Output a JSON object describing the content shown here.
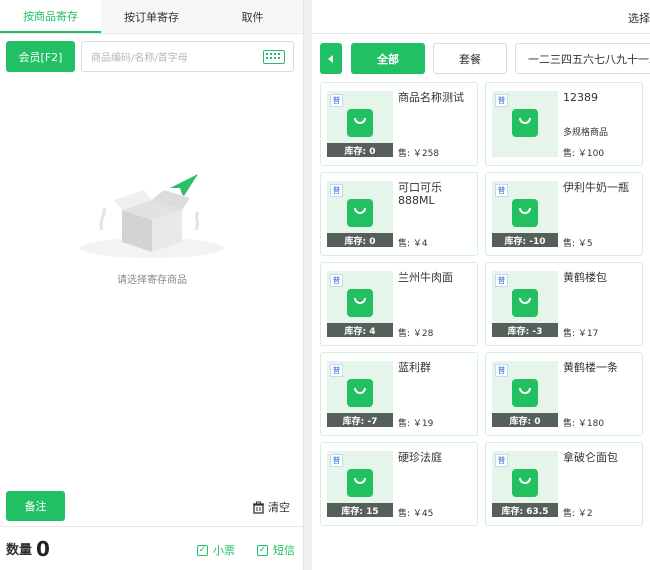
{
  "left": {
    "tabs": [
      "按商品寄存",
      "按订单寄存",
      "取件"
    ],
    "member_button": "会员[F2]",
    "search_placeholder": "商品编码/名称/首字母",
    "empty_text": "请选择寄存商品",
    "remark_button": "备注",
    "clear_label": "清空",
    "quantity_label": "数量",
    "quantity_value": "0",
    "options": [
      {
        "label": "小票",
        "checked": true
      },
      {
        "label": "短信",
        "checked": true
      }
    ]
  },
  "right": {
    "select_link": "选择",
    "categories": [
      "全部",
      "套餐",
      "一二三四五六七八九十一二"
    ],
    "products": [
      {
        "tag": "普",
        "name": "商品名称测试",
        "spec": "",
        "stock_label": "库存: 0",
        "price": "售: ￥258"
      },
      {
        "tag": "普",
        "name": "12389",
        "spec": "多规格商品",
        "stock_label": "",
        "price": "售: ￥100"
      },
      {
        "tag": "普",
        "name": "可口可乐888ML",
        "spec": "",
        "stock_label": "库存: 0",
        "price": "售: ￥4"
      },
      {
        "tag": "普",
        "name": "伊利牛奶一瓶",
        "spec": "",
        "stock_label": "库存: -10",
        "price": "售: ￥5"
      },
      {
        "tag": "普",
        "name": "兰州牛肉面",
        "spec": "",
        "stock_label": "库存: 4",
        "price": "售: ￥28"
      },
      {
        "tag": "普",
        "name": "黄鹤楼包",
        "spec": "",
        "stock_label": "库存: -3",
        "price": "售: ￥17"
      },
      {
        "tag": "普",
        "name": "蓝利群",
        "spec": "",
        "stock_label": "库存: -7",
        "price": "售: ￥19"
      },
      {
        "tag": "普",
        "name": "黄鹤楼一条",
        "spec": "",
        "stock_label": "库存: 0",
        "price": "售: ￥180"
      },
      {
        "tag": "普",
        "name": "硬珍法庭",
        "spec": "",
        "stock_label": "库存: 15",
        "price": "售: ￥45"
      },
      {
        "tag": "普",
        "name": "拿破仑面包",
        "spec": "",
        "stock_label": "库存: 63.5",
        "price": "售: ￥2"
      }
    ]
  },
  "colors": {
    "accent": "#22c065",
    "stock_bar": "#56605b",
    "thumb_bg": "#e6f5ea"
  }
}
